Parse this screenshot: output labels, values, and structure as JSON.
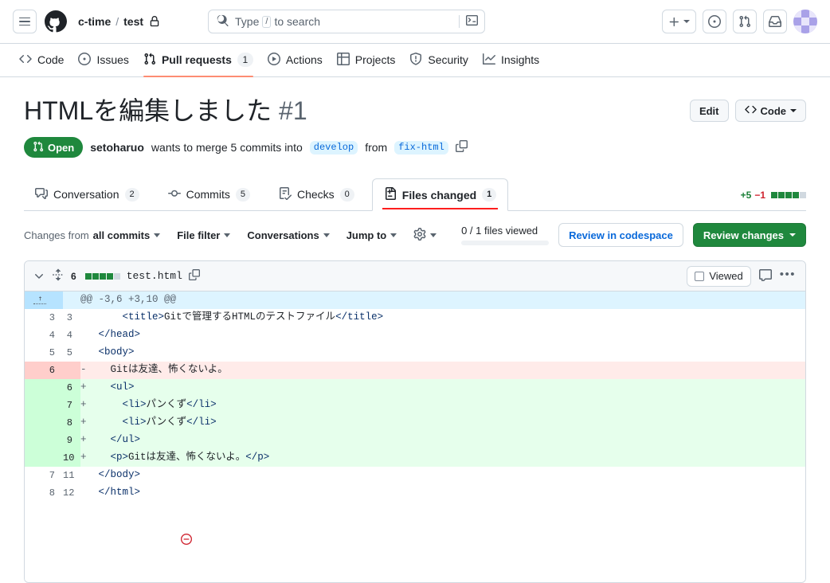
{
  "header": {
    "menu_icon": "hamburger-icon",
    "logo_icon": "github-logo-icon",
    "owner": "c-time",
    "slash": "/",
    "repo": "test",
    "lock_icon": "lock-icon",
    "search": {
      "icon": "search-icon",
      "placeholder_prefix": "Type",
      "slash_key": "/",
      "placeholder_suffix": "to search",
      "terminal_icon": "terminal-icon"
    },
    "actions": [
      {
        "name": "create-new-button",
        "icon": "plus-icon",
        "has_caret": true
      },
      {
        "name": "issues-button",
        "icon": "issue-opened-icon"
      },
      {
        "name": "pull-requests-button",
        "icon": "git-pull-request-icon"
      },
      {
        "name": "inbox-button",
        "icon": "inbox-icon"
      }
    ],
    "avatar_alt": "user-avatar"
  },
  "repo_nav": [
    {
      "label": "Code",
      "icon": "code-icon",
      "count": null,
      "active": false
    },
    {
      "label": "Issues",
      "icon": "issue-opened-icon",
      "count": null,
      "active": false
    },
    {
      "label": "Pull requests",
      "icon": "git-pull-request-icon",
      "count": "1",
      "active": true
    },
    {
      "label": "Actions",
      "icon": "play-icon",
      "count": null,
      "active": false
    },
    {
      "label": "Projects",
      "icon": "table-icon",
      "count": null,
      "active": false
    },
    {
      "label": "Security",
      "icon": "shield-icon",
      "count": null,
      "active": false
    },
    {
      "label": "Insights",
      "icon": "graph-icon",
      "count": null,
      "active": false
    }
  ],
  "pull_request": {
    "title": "HTMLを編集しました",
    "number": "#1",
    "edit_label": "Edit",
    "code_label": "Code",
    "code_icon": "code-icon",
    "state": "Open",
    "state_icon": "git-pull-request-icon",
    "state_color": "#1f883d",
    "author": "setoharuo",
    "merge_text_1": "wants to merge 5 commits into",
    "base_branch": "develop",
    "merge_text_2": "from",
    "head_branch": "fix-html",
    "copy_icon": "copy-icon"
  },
  "pr_tabs": [
    {
      "label": "Conversation",
      "icon": "comment-discussion-icon",
      "count": "2",
      "active": false
    },
    {
      "label": "Commits",
      "icon": "git-commit-icon",
      "count": "5",
      "active": false
    },
    {
      "label": "Checks",
      "icon": "checklist-icon",
      "count": "0",
      "active": false
    },
    {
      "label": "Files changed",
      "icon": "file-diff-icon",
      "count": "1",
      "active": true
    }
  ],
  "diffstat": {
    "additions": "+5",
    "deletions": "−1",
    "blocks_filled": 4,
    "blocks_empty": 1,
    "add_color": "#1a7f37",
    "del_color": "#cf222e"
  },
  "filters": {
    "changes_prefix": "Changes from",
    "changes_value": "all commits",
    "file_filter": "File filter",
    "conversations": "Conversations",
    "jump_to": "Jump to",
    "gear_icon": "gear-icon",
    "viewed_text": "0 / 1 files viewed",
    "progress_percent": 0,
    "review_codespace": "Review in codespace",
    "review_changes": "Review changes"
  },
  "file": {
    "chevron_icon": "chevron-down-icon",
    "diff_icon": "diff-expand-icon",
    "change_count": "6",
    "blocks_filled": 4,
    "blocks_empty": 1,
    "filename": "test.html",
    "copy_icon": "copy-icon",
    "viewed_label": "Viewed",
    "viewed_checked": false,
    "comment_icon": "comment-icon",
    "kebab_icon": "kebab-horizontal-icon"
  },
  "diff": {
    "hunk_header": "@@ -3,6 +3,10 @@",
    "expand_icon": "expand-up-icon",
    "rows": [
      {
        "type": "ctx",
        "old": "3",
        "new": "3",
        "marker": "",
        "tokens": [
          {
            "t": "plain",
            "v": "    "
          },
          {
            "t": "tag",
            "v": "<title>"
          },
          {
            "t": "plain",
            "v": "Gitで管理するHTMLのテストファイル"
          },
          {
            "t": "tag",
            "v": "</title>"
          }
        ]
      },
      {
        "type": "ctx",
        "old": "4",
        "new": "4",
        "marker": "",
        "tokens": [
          {
            "t": "tag",
            "v": "</head>"
          }
        ]
      },
      {
        "type": "ctx",
        "old": "5",
        "new": "5",
        "marker": "",
        "tokens": [
          {
            "t": "tag",
            "v": "<body>"
          }
        ]
      },
      {
        "type": "del",
        "old": "6",
        "new": "",
        "marker": "-",
        "tokens": [
          {
            "t": "plain",
            "v": "  Gitは友達、怖くないよ。"
          }
        ]
      },
      {
        "type": "add",
        "old": "",
        "new": "6",
        "marker": "+",
        "tokens": [
          {
            "t": "tag",
            "v": "  <ul>"
          }
        ]
      },
      {
        "type": "add",
        "old": "",
        "new": "7",
        "marker": "+",
        "tokens": [
          {
            "t": "tag",
            "v": "    <li>"
          },
          {
            "t": "plain",
            "v": "パンくず"
          },
          {
            "t": "tag",
            "v": "</li>"
          }
        ]
      },
      {
        "type": "add",
        "old": "",
        "new": "8",
        "marker": "+",
        "tokens": [
          {
            "t": "tag",
            "v": "    <li>"
          },
          {
            "t": "plain",
            "v": "パンくず"
          },
          {
            "t": "tag",
            "v": "</li>"
          }
        ]
      },
      {
        "type": "add",
        "old": "",
        "new": "9",
        "marker": "+",
        "tokens": [
          {
            "t": "tag",
            "v": "  </ul>"
          }
        ]
      },
      {
        "type": "add",
        "old": "",
        "new": "10",
        "marker": "+",
        "tokens": [
          {
            "t": "tag",
            "v": "  <p>"
          },
          {
            "t": "plain",
            "v": "Gitは友達、怖くないよ。"
          },
          {
            "t": "tag",
            "v": "</p>"
          }
        ]
      },
      {
        "type": "ctx",
        "old": "7",
        "new": "11",
        "marker": "",
        "tokens": [
          {
            "t": "tag",
            "v": "</body>"
          }
        ]
      },
      {
        "type": "ctx",
        "old": "8",
        "new": "12",
        "marker": "",
        "tokens": [
          {
            "t": "tag",
            "v": "</html>"
          }
        ]
      }
    ],
    "no_newline_icon": "no-newline-icon"
  }
}
